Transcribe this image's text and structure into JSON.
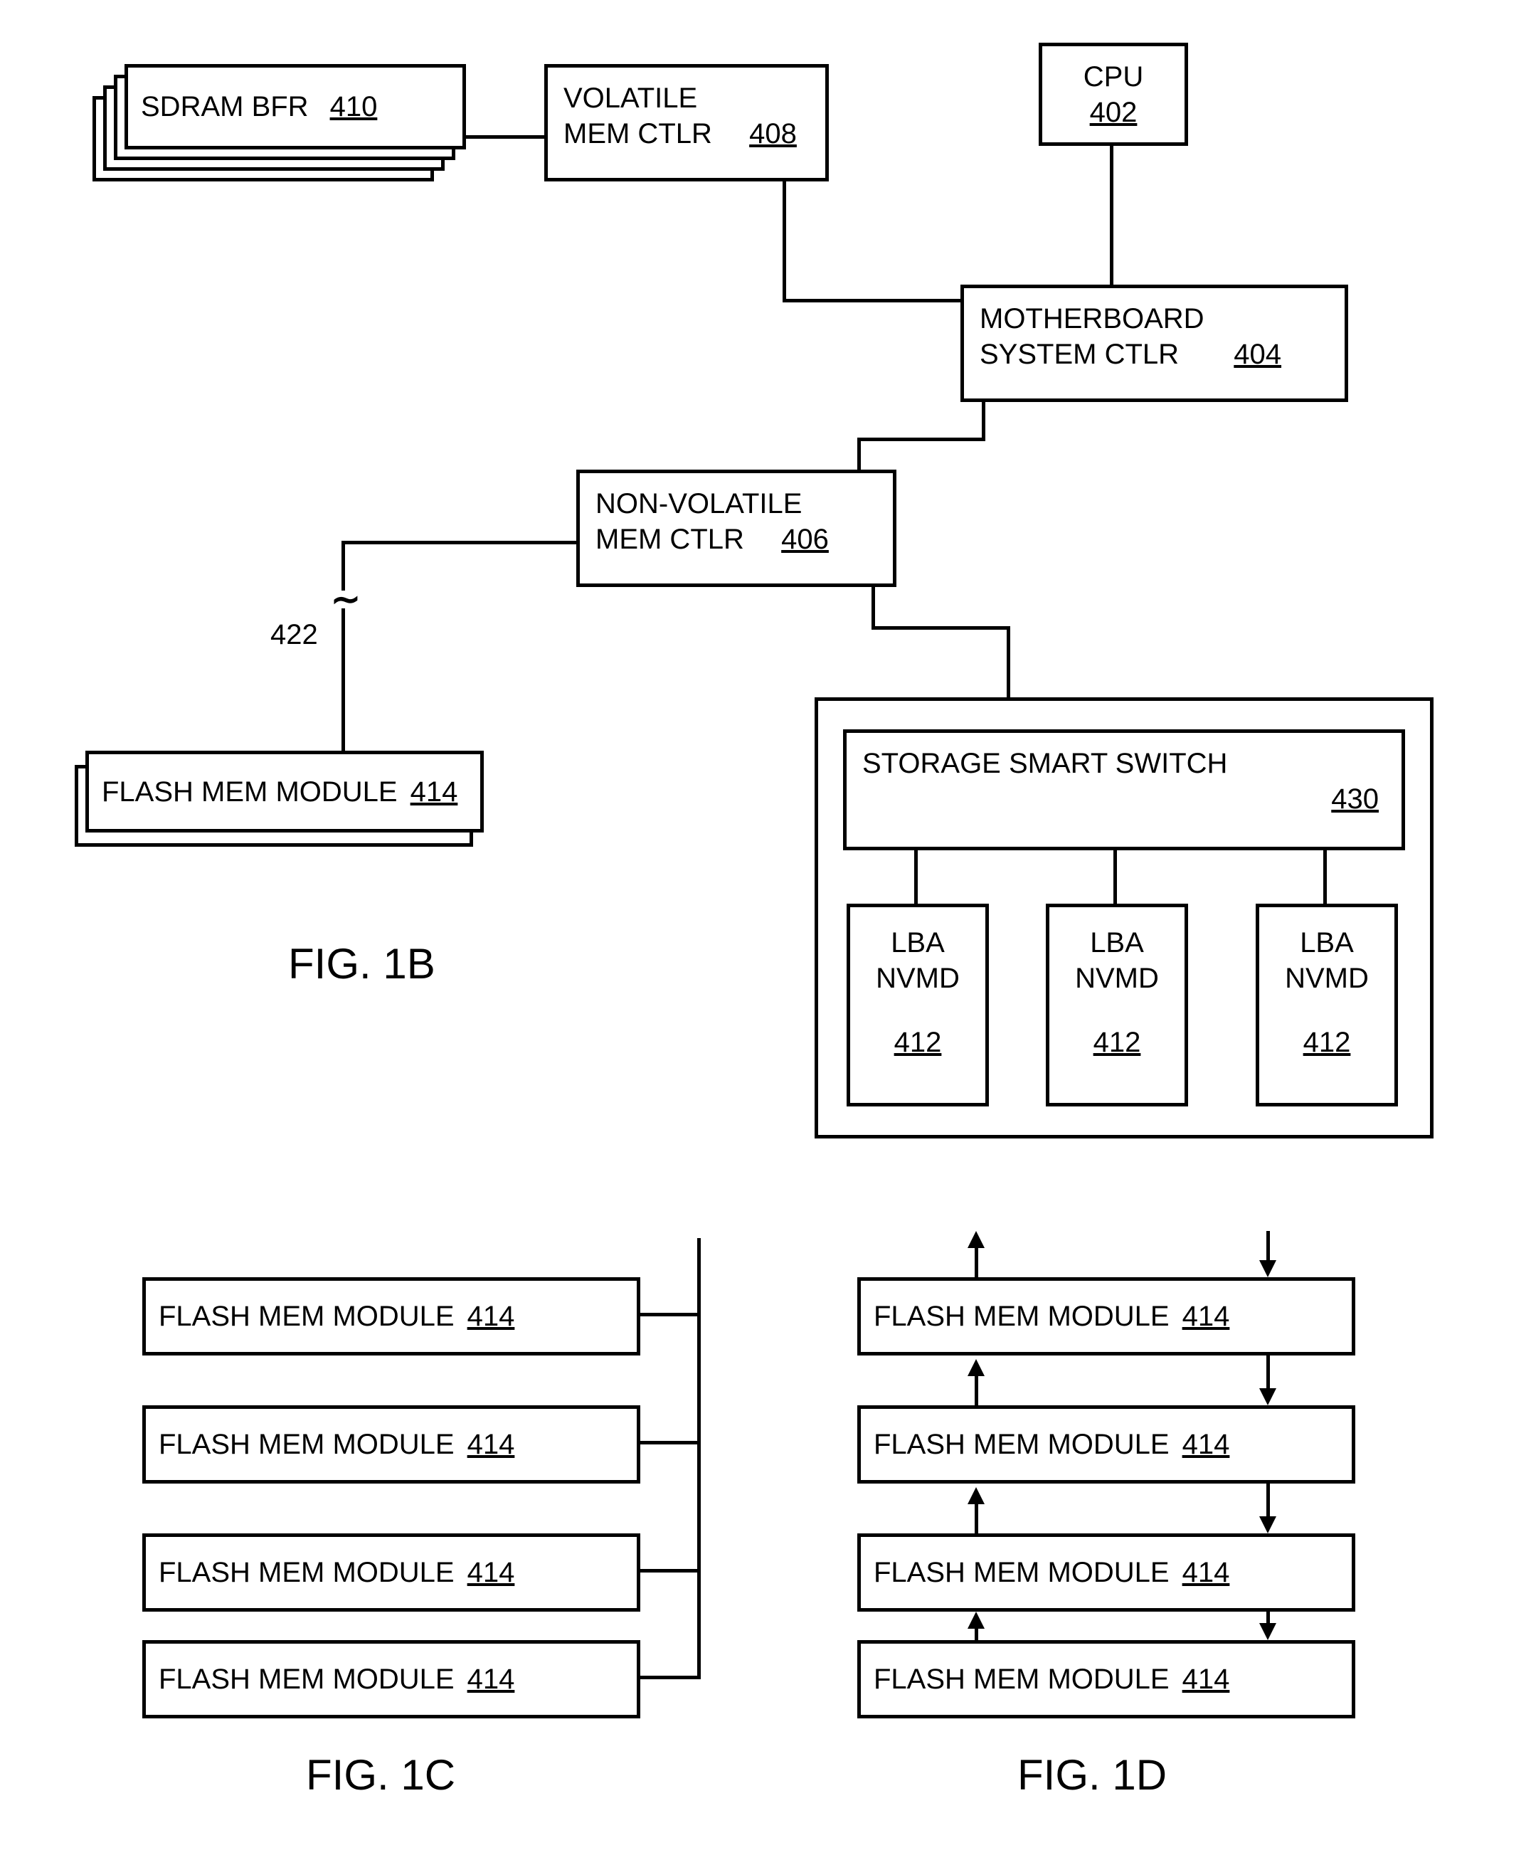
{
  "fig1b": {
    "sdram": {
      "label": "SDRAM  BFR",
      "ref": "410"
    },
    "vmem": {
      "label1": "VOLATILE",
      "label2": "MEM CTLR",
      "ref": "408"
    },
    "cpu": {
      "label": "CPU",
      "ref": "402"
    },
    "mb": {
      "label1": "MOTHERBOARD",
      "label2": "SYSTEM CTLR",
      "ref": "404"
    },
    "nvmem": {
      "label1": "NON-VOLATILE",
      "label2": "MEM CTLR",
      "ref": "406"
    },
    "ref422": "422",
    "flash": {
      "label": "FLASH MEM MODULE",
      "ref": "414"
    },
    "sss": {
      "label": "STORAGE SMART SWITCH",
      "ref": "430"
    },
    "lba": {
      "label1": "LBA",
      "label2": "NVMD",
      "ref": "412"
    },
    "caption": "FIG. 1B"
  },
  "fig1c": {
    "flash": {
      "label": "FLASH MEM MODULE",
      "ref": "414"
    },
    "caption": "FIG. 1C"
  },
  "fig1d": {
    "flash": {
      "label": "FLASH MEM MODULE",
      "ref": "414"
    },
    "caption": "FIG. 1D"
  }
}
